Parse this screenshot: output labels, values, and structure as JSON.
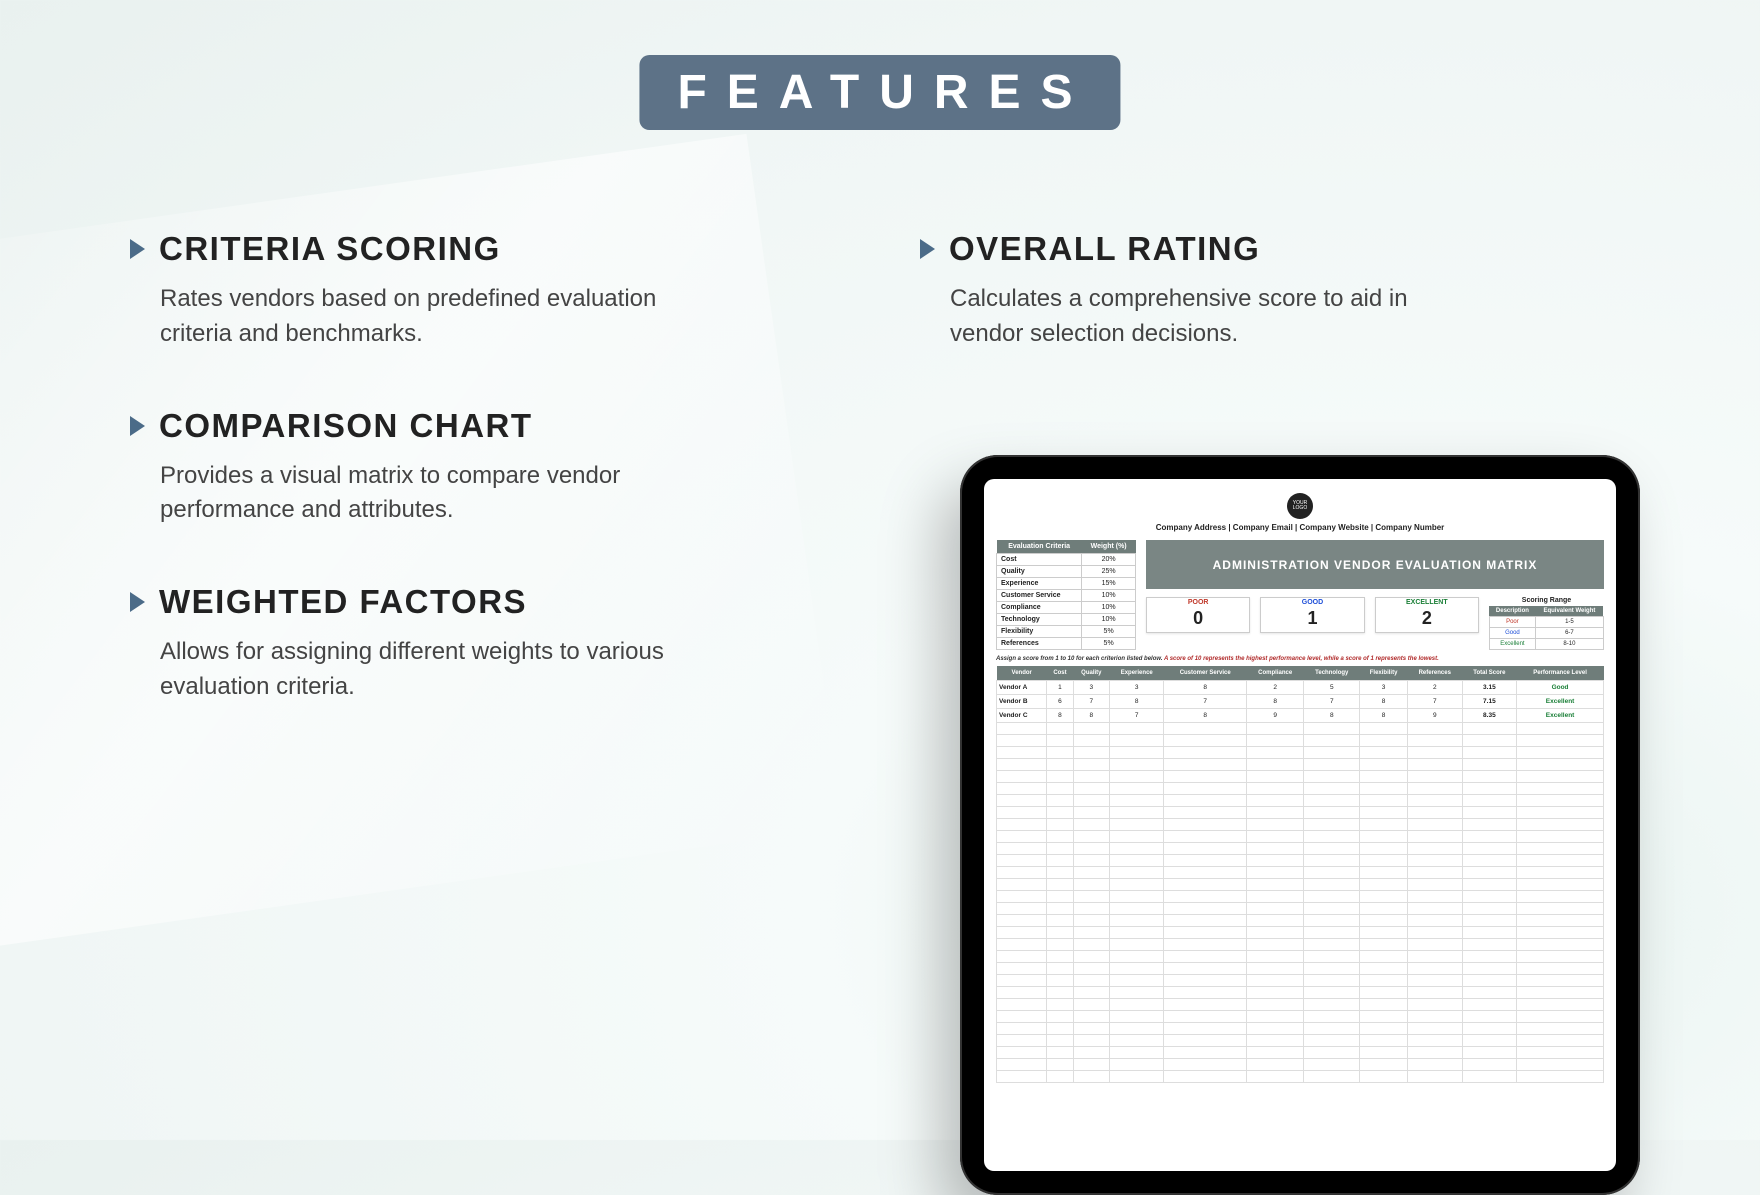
{
  "badge": "FEATURES",
  "features": {
    "left": [
      {
        "title": "CRITERIA SCORING",
        "desc": "Rates vendors based on predefined evaluation criteria and benchmarks."
      },
      {
        "title": "COMPARISON CHART",
        "desc": "Provides a visual matrix to compare vendor performance and attributes."
      },
      {
        "title": "WEIGHTED FACTORS",
        "desc": "Allows for assigning different weights to various evaluation criteria."
      }
    ],
    "right": [
      {
        "title": "OVERALL RATING",
        "desc": "Calculates a comprehensive score to aid in vendor selection decisions."
      }
    ]
  },
  "tablet": {
    "logo_text": "YOUR LOGO",
    "company_line": "Company Address  |  Company Email  |  Company Website  |  Company Number",
    "criteria_header": {
      "c1": "Evaluation Criteria",
      "c2": "Weight (%)"
    },
    "criteria": [
      {
        "name": "Cost",
        "weight": "20%"
      },
      {
        "name": "Quality",
        "weight": "25%"
      },
      {
        "name": "Experience",
        "weight": "15%"
      },
      {
        "name": "Customer Service",
        "weight": "10%"
      },
      {
        "name": "Compliance",
        "weight": "10%"
      },
      {
        "name": "Technology",
        "weight": "10%"
      },
      {
        "name": "Flexibility",
        "weight": "5%"
      },
      {
        "name": "References",
        "weight": "5%"
      }
    ],
    "title": "ADMINISTRATION VENDOR EVALUATION MATRIX",
    "score_boxes": {
      "poor": {
        "label": "POOR",
        "value": "0"
      },
      "good": {
        "label": "GOOD",
        "value": "1"
      },
      "exc": {
        "label": "EXCELLENT",
        "value": "2"
      }
    },
    "range_title": "Scoring Range",
    "range_header": {
      "c1": "Description",
      "c2": "Equivalent Weight"
    },
    "range": [
      {
        "desc": "Poor",
        "val": "1-5"
      },
      {
        "desc": "Good",
        "val": "6-7"
      },
      {
        "desc": "Excellent",
        "val": "8-10"
      }
    ],
    "instruction_prefix": "Assign a score from 1 to 10 for each criterion listed below. ",
    "instruction_red": "A score of 10 represents the highest performance level, while a score of 1 represents the lowest.",
    "grid_headers": [
      "Vendor",
      "Cost",
      "Quality",
      "Experience",
      "Customer Service",
      "Compliance",
      "Technology",
      "Flexibility",
      "References",
      "Total Score",
      "Performance Level"
    ],
    "vendors": [
      {
        "cells": [
          "Vendor A",
          "1",
          "3",
          "3",
          "8",
          "2",
          "5",
          "3",
          "2",
          "3.15",
          "Good"
        ],
        "pl_class": "pl-good"
      },
      {
        "cells": [
          "Vendor B",
          "6",
          "7",
          "8",
          "7",
          "8",
          "7",
          "8",
          "7",
          "7.15",
          "Excellent"
        ],
        "pl_class": "pl-exc"
      },
      {
        "cells": [
          "Vendor C",
          "8",
          "8",
          "7",
          "8",
          "9",
          "8",
          "8",
          "9",
          "8.35",
          "Excellent"
        ],
        "pl_class": "pl-exc"
      }
    ]
  }
}
